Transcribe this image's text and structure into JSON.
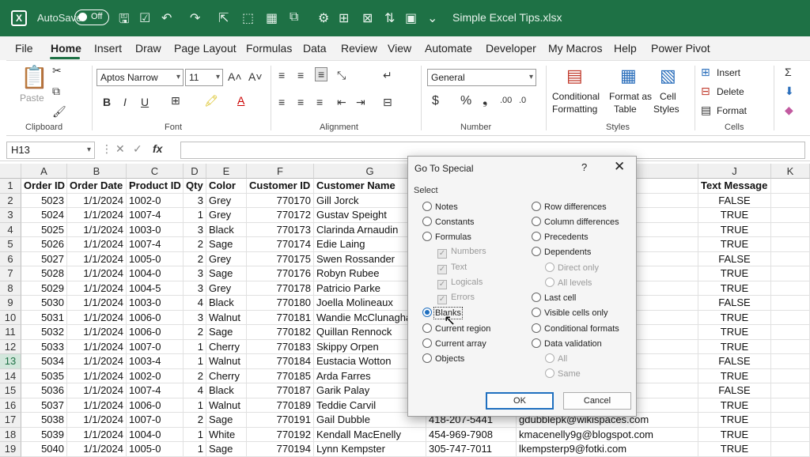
{
  "titlebar": {
    "autosave": "AutoSave",
    "toggle": "Off",
    "filename": "Simple Excel Tips.xlsx"
  },
  "menu": [
    "File",
    "Home",
    "Insert",
    "Draw",
    "Page Layout",
    "Formulas",
    "Data",
    "Review",
    "View",
    "Automate",
    "Developer",
    "My Macros",
    "Help",
    "Power Pivot"
  ],
  "ribbon": {
    "clipboard": {
      "paste": "Paste",
      "label": "Clipboard"
    },
    "font": {
      "name": "Aptos Narrow",
      "size": "11",
      "label": "Font"
    },
    "alignment": {
      "label": "Alignment"
    },
    "number": {
      "format": "General",
      "label": "Number"
    },
    "styles": {
      "cond": "Conditional",
      "cond2": "Formatting",
      "fmt": "Format as",
      "fmt2": "Table",
      "cell": "Cell",
      "cell2": "Styles",
      "label": "Styles"
    },
    "cells": {
      "insert": "Insert",
      "delete": "Delete",
      "format": "Format",
      "label": "Cells"
    }
  },
  "namebox": "H13",
  "columns": [
    "A",
    "B",
    "C",
    "D",
    "E",
    "F",
    "G",
    "H",
    "I",
    "J",
    "K"
  ],
  "rows": [
    {
      "n": "1",
      "a": "Order ID",
      "b": "Order Date",
      "c": "Product ID",
      "d": "Qty",
      "e": "Color",
      "f": "Customer ID",
      "g": "Customer Name",
      "h": "",
      "i": "",
      "j": "Text Message"
    },
    {
      "n": "2",
      "a": "5023",
      "b": "1/1/2024",
      "c": "1002-0",
      "d": "3",
      "e": "Grey",
      "f": "770170",
      "g": "Gill Jorck",
      "h": "",
      "i": "",
      "j": "FALSE"
    },
    {
      "n": "3",
      "a": "5024",
      "b": "1/1/2024",
      "c": "1007-4",
      "d": "1",
      "e": "Grey",
      "f": "770172",
      "g": "Gustav Speight",
      "h": "",
      "i": "",
      "j": "TRUE"
    },
    {
      "n": "4",
      "a": "5025",
      "b": "1/1/2024",
      "c": "1003-0",
      "d": "3",
      "e": "Black",
      "f": "770173",
      "g": "Clarinda Arnaudin",
      "h": "",
      "i": "",
      "j": "TRUE"
    },
    {
      "n": "5",
      "a": "5026",
      "b": "1/1/2024",
      "c": "1007-4",
      "d": "2",
      "e": "Sage",
      "f": "770174",
      "g": "Edie Laing",
      "h": "",
      "i": "",
      "j": "TRUE"
    },
    {
      "n": "6",
      "a": "5027",
      "b": "1/1/2024",
      "c": "1005-0",
      "d": "2",
      "e": "Grey",
      "f": "770175",
      "g": "Swen Rossander",
      "h": "",
      "i": ".com",
      "j": "FALSE"
    },
    {
      "n": "7",
      "a": "5028",
      "b": "1/1/2024",
      "c": "1004-0",
      "d": "3",
      "e": "Sage",
      "f": "770176",
      "g": "Robyn Rubee",
      "h": "",
      "i": "",
      "j": "TRUE"
    },
    {
      "n": "8",
      "a": "5029",
      "b": "1/1/2024",
      "c": "1004-5",
      "d": "3",
      "e": "Grey",
      "f": "770178",
      "g": "Patricio Parke",
      "h": "",
      "i": "",
      "j": "TRUE"
    },
    {
      "n": "9",
      "a": "5030",
      "b": "1/1/2024",
      "c": "1003-0",
      "d": "4",
      "e": "Black",
      "f": "770180",
      "g": "Joella Molineaux",
      "h": "",
      "i": "p",
      "j": "FALSE"
    },
    {
      "n": "10",
      "a": "5031",
      "b": "1/1/2024",
      "c": "1006-0",
      "d": "3",
      "e": "Walnut",
      "f": "770181",
      "g": "Wandie McClunaghan",
      "h": "",
      "i": ".jp",
      "j": "TRUE"
    },
    {
      "n": "11",
      "a": "5032",
      "b": "1/1/2024",
      "c": "1006-0",
      "d": "2",
      "e": "Sage",
      "f": "770182",
      "g": "Quillan Rennock",
      "h": "",
      "i": "",
      "j": "TRUE"
    },
    {
      "n": "12",
      "a": "5033",
      "b": "1/1/2024",
      "c": "1007-0",
      "d": "1",
      "e": "Cherry",
      "f": "770183",
      "g": "Skippy Orpen",
      "h": "",
      "i": "",
      "j": "TRUE"
    },
    {
      "n": "13",
      "a": "5034",
      "b": "1/1/2024",
      "c": "1003-4",
      "d": "1",
      "e": "Walnut",
      "f": "770184",
      "g": "Eustacia Wotton",
      "h": "",
      "i": "com",
      "j": "FALSE"
    },
    {
      "n": "14",
      "a": "5035",
      "b": "1/1/2024",
      "c": "1002-0",
      "d": "2",
      "e": "Cherry",
      "f": "770185",
      "g": "Arda Farres",
      "h": "",
      "i": "",
      "j": "TRUE"
    },
    {
      "n": "15",
      "a": "5036",
      "b": "1/1/2024",
      "c": "1007-4",
      "d": "4",
      "e": "Black",
      "f": "770187",
      "g": "Garik Palay",
      "h": "",
      "i": "",
      "j": "FALSE"
    },
    {
      "n": "16",
      "a": "5037",
      "b": "1/1/2024",
      "c": "1006-0",
      "d": "1",
      "e": "Walnut",
      "f": "770189",
      "g": "Teddie Carvil",
      "h": "",
      "i": "",
      "j": "TRUE"
    },
    {
      "n": "17",
      "a": "5038",
      "b": "1/1/2024",
      "c": "1007-0",
      "d": "2",
      "e": "Sage",
      "f": "770191",
      "g": "Gail Dubble",
      "h": "418-207-5441",
      "i": "gdubblepk@wikispaces.com",
      "j": "TRUE"
    },
    {
      "n": "18",
      "a": "5039",
      "b": "1/1/2024",
      "c": "1004-0",
      "d": "1",
      "e": "White",
      "f": "770192",
      "g": "Kendall MacEnelly",
      "h": "454-969-7908",
      "i": "kmacenelly9g@blogspot.com",
      "j": "TRUE"
    },
    {
      "n": "19",
      "a": "5040",
      "b": "1/1/2024",
      "c": "1005-0",
      "d": "1",
      "e": "Sage",
      "f": "770194",
      "g": "Lynn Kempster",
      "h": "305-747-7011",
      "i": "lkempsterp9@fotki.com",
      "j": "TRUE"
    }
  ],
  "dialog": {
    "title": "Go To Special",
    "help": "?",
    "close": "✕",
    "select": "Select",
    "left": [
      "Notes",
      "Constants",
      "Formulas",
      "Numbers",
      "Text",
      "Logicals",
      "Errors",
      "Blanks",
      "Current region",
      "Current array",
      "Objects"
    ],
    "right": [
      "Row differences",
      "Column differences",
      "Precedents",
      "Dependents",
      "Direct only",
      "All levels",
      "Last cell",
      "Visible cells only",
      "Conditional formats",
      "Data validation",
      "All",
      "Same"
    ],
    "ok": "OK",
    "cancel": "Cancel"
  }
}
